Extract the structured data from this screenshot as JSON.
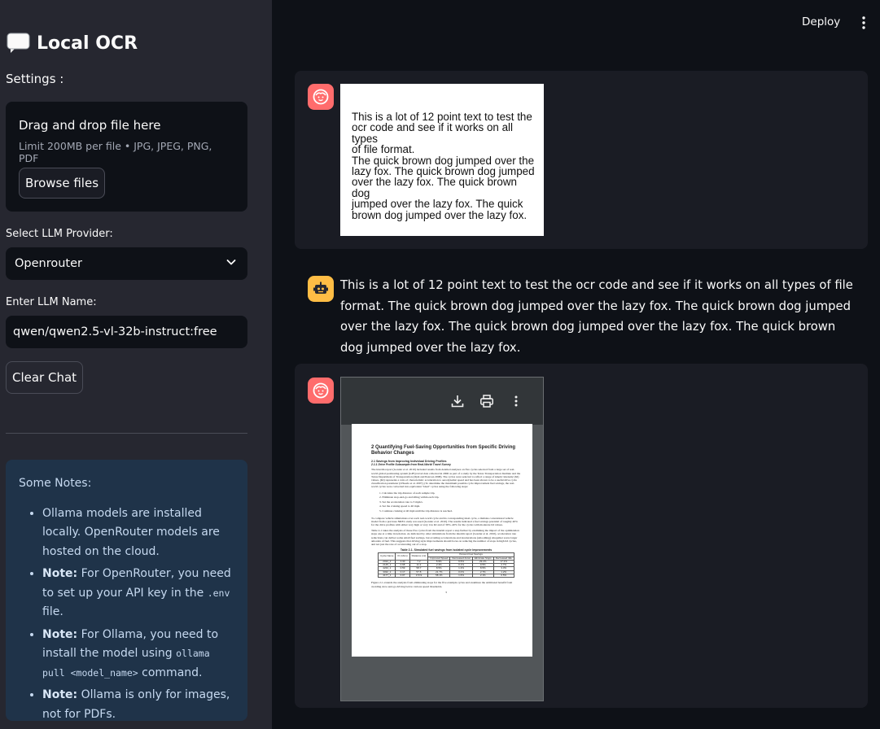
{
  "sidebar": {
    "title": "Local OCR",
    "title_icon": "speech-bubble-icon",
    "settings_label": "Settings :",
    "uploader": {
      "prompt": "Drag and drop file here",
      "limit": "Limit 200MB per file • JPG, JPEG, PNG, PDF",
      "browse_label": "Browse files"
    },
    "provider": {
      "label": "Select LLM Provider:",
      "value": "Openrouter"
    },
    "llm_name": {
      "label": "Enter LLM Name:",
      "value": "qwen/qwen2.5-vl-32b-instruct:free"
    },
    "clear_label": "Clear Chat",
    "notes": {
      "title": "Some Notes:",
      "items": [
        {
          "bold": "",
          "text": "Ollama models are installed locally. OpenRouter models are hosted on the cloud."
        },
        {
          "bold": "Note:",
          "text_before": " For OpenRouter, you need to set up your API key in the ",
          "code": ".env",
          "text_after": " file."
        },
        {
          "bold": "Note:",
          "text_before": " For Ollama, you need to install the model using ",
          "code": "ollama pull <model_name>",
          "text_after": " command."
        },
        {
          "bold": "Note:",
          "text": " Ollama is only for images, not for PDFs."
        }
      ]
    }
  },
  "header": {
    "deploy_label": "Deploy"
  },
  "chat": {
    "image_message": {
      "lines": "This is a lot of 12 point text to test the\nocr code and see if it works on  all types\nof file format.\nThe quick brown dog jumped over the\nlazy fox. The quick brown dog jumped\nover the lazy fox. The quick brown dog\n jumped over the lazy fox. The quick\nbrown dog jumped over the lazy fox."
    },
    "assistant_message": "This is a lot of 12 point text to test the ocr code and see if it works on all types of file format. The quick brown dog jumped over the lazy fox. The quick brown dog jumped over the lazy fox. The quick brown dog jumped over the lazy fox. The quick brown dog jumped over the lazy fox.",
    "pdf_message": {
      "heading": "2   Quantifying Fuel-Saving Opportunities from Specific Driving Behavior Changes",
      "subheading": "2.1   Savings from Improving Individual Driving Profiles",
      "subheading2": "2.1.1   Drive Profile Subsample from Real-World Travel Survey",
      "para1": "The interim report (Gonder et al. 2010) included results from detailed analyses on five cycles selected from a large set of real-world global positioning system (GPS) travel data collected in 2006 as part of a study by the Texas Transportation Institute and the Texas Department of Transportation (Ojah and Pearson 2008). The cycles were selected to reflect a range of kinetic intensity (KI) values. (KI) represents a ratio of characteristic acceleration to aerodynamic speed and has been shown to be a useful drive cycle classification parameter (O'Keefe et al. 2007).) To determine the maximum possible cycle improvement fuel savings, the real-world cycles were converted into equivalent \"ideal\" cycles using the following steps:",
      "steps": [
        "1.   Calculate the trip distance of each sample trip.",
        "2.   Eliminate stop-and-go and idling within each trip.",
        "3.   Set the acceleration rate to 3 mph/s.",
        "4.   Set the cruising speed to 40 mph.",
        "5.   Continue cruising at 40 mph until the trip distance is reached."
      ],
      "para2": "To compare vehicle simulations over each real-world cycle and its corresponding ideal cycle, a midsize conventional vehicle model from a previous NREL study was used (Gonder et al. 2010). The results indicated a fuel savings potential of roughly 40% for the drive profiles with either very high or very low KI and of 30%–40% for the cycles with moderate KI values.",
      "para3": "Table 2-1 takes the analysis of these five cycles from the interim report a step further by examining the impact of the optimization steps one at a time in isolation. As indicated by other simulations from the interim report (Gonder et al. 2010), acceleration rate reductions can deliver some small fuel savings, but avoiding accelerations and decelerations (smoothing) altogether saves larger amounts of fuel. This suggests that driving style improvements should focus on reducing the number of stops in high KI cycles, and not just the rate of accelerating out of a stop.",
      "table_caption": "Table 2-1. Simulated fuel savings from isolated cycle improvements",
      "table_header": [
        "Cycle Name",
        "KI (1/km)",
        "Distance (mi)",
        "Improved Speed",
        "Decreased Accel",
        "Eliminate Stops",
        "Decreased Idle"
      ],
      "table_group_header": "Percent Fuel Savings",
      "table_rows": [
        [
          "2012_2",
          "3.30",
          "7.2",
          "5.9%",
          "9.5%",
          "29.2%",
          "17.2%"
        ],
        [
          "2145_1",
          "0.68",
          "11.2",
          "2.4%",
          "0.1%",
          "9.5%",
          "2.7%"
        ],
        [
          "4234_1",
          "0.59",
          "58.7",
          "8.5%",
          "1.3%",
          "8.5%",
          "3.3%"
        ],
        [
          "3032_2",
          "0.17",
          "57.8",
          "21.7%",
          "0.0%",
          "2.7%",
          "1.2%"
        ],
        [
          "4177_1",
          "0.07",
          "173.9",
          "58.1%",
          "1.6%",
          "2.1%",
          "0.5%"
        ]
      ],
      "para4": "Figure 2-1 extends the analysis from eliminating stops for the five example cycles and examines the additional benefit from avoiding slow-and-go driving below various speed thresholds.",
      "page_number": "3"
    }
  }
}
